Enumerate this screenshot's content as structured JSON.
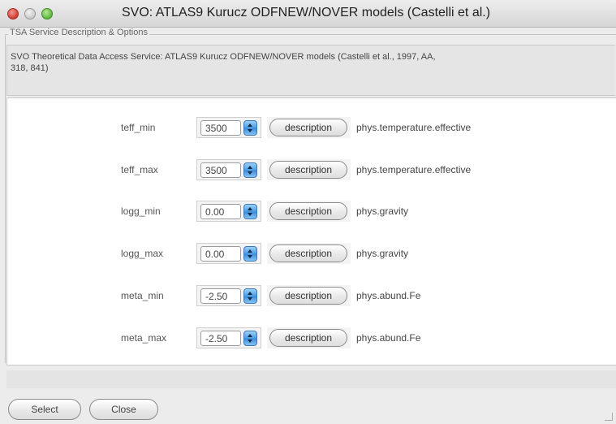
{
  "window": {
    "title": "SVO: ATLAS9 Kurucz ODFNEW/NOVER models (Castelli et al.)"
  },
  "group": {
    "legend": "TSA Service Description & Options",
    "description": "SVO Theoretical Data Access Service: ATLAS9 Kurucz ODFNEW/NOVER models (Castelli et al., 1997, AA,\n318, 841)"
  },
  "params": [
    {
      "name": "teff_min",
      "value": "3500",
      "button": "description",
      "ucd": "phys.temperature.effective"
    },
    {
      "name": "teff_max",
      "value": "3500",
      "button": "description",
      "ucd": "phys.temperature.effective"
    },
    {
      "name": "logg_min",
      "value": "0.00",
      "button": "description",
      "ucd": "phys.gravity"
    },
    {
      "name": "logg_max",
      "value": "0.00",
      "button": "description",
      "ucd": "phys.gravity"
    },
    {
      "name": "meta_min",
      "value": "-2.50",
      "button": "description",
      "ucd": "phys.abund.Fe"
    },
    {
      "name": "meta_max",
      "value": "-2.50",
      "button": "description",
      "ucd": "phys.abund.Fe"
    }
  ],
  "footer": {
    "select_label": "Select",
    "close_label": "Close"
  },
  "colors": {
    "stepper_accent": "#4a9de0",
    "close_light": "#cf3a2e",
    "zoom_light": "#5cb83a"
  }
}
